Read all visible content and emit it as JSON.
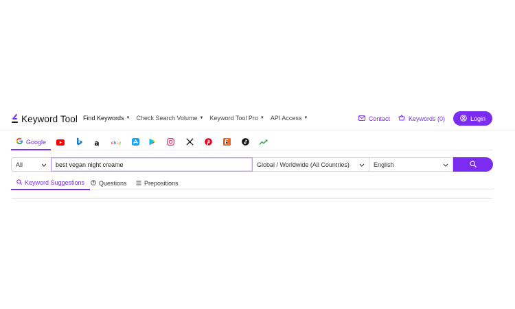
{
  "brand": {
    "name": "Keyword Tool",
    "accent": "#7b2cf0"
  },
  "nav": [
    {
      "label": "Find Keywords",
      "active": true
    },
    {
      "label": "Check Search Volume",
      "active": false
    },
    {
      "label": "Keyword Tool Pro",
      "active": false
    },
    {
      "label": "API Access",
      "active": false
    }
  ],
  "header_right": {
    "contact": "Contact",
    "keywords": "Keywords (0)",
    "login": "Login"
  },
  "sources": [
    {
      "name": "google-icon",
      "label": "Google",
      "active": true
    },
    {
      "name": "youtube-icon",
      "label": "",
      "active": false
    },
    {
      "name": "bing-icon",
      "label": "",
      "active": false
    },
    {
      "name": "amazon-icon",
      "label": "",
      "active": false
    },
    {
      "name": "ebay-icon",
      "label": "",
      "active": false
    },
    {
      "name": "app-store-icon",
      "label": "",
      "active": false
    },
    {
      "name": "play-store-icon",
      "label": "",
      "active": false
    },
    {
      "name": "instagram-icon",
      "label": "",
      "active": false
    },
    {
      "name": "x-icon",
      "label": "",
      "active": false
    },
    {
      "name": "pinterest-icon",
      "label": "",
      "active": false
    },
    {
      "name": "etsy-icon",
      "label": "",
      "active": false
    },
    {
      "name": "tiktok-icon",
      "label": "",
      "active": false
    },
    {
      "name": "trends-icon",
      "label": "",
      "active": false
    }
  ],
  "search": {
    "filter": "All",
    "query": "best vegan night creame",
    "location": "Global / Worldwide (All Countries)",
    "language": "English"
  },
  "result_tabs": [
    {
      "label": "Keyword Suggestions",
      "icon": "search-icon",
      "active": true
    },
    {
      "label": "Questions",
      "icon": "question-icon",
      "active": false
    },
    {
      "label": "Prepositions",
      "icon": "list-icon",
      "active": false
    }
  ]
}
